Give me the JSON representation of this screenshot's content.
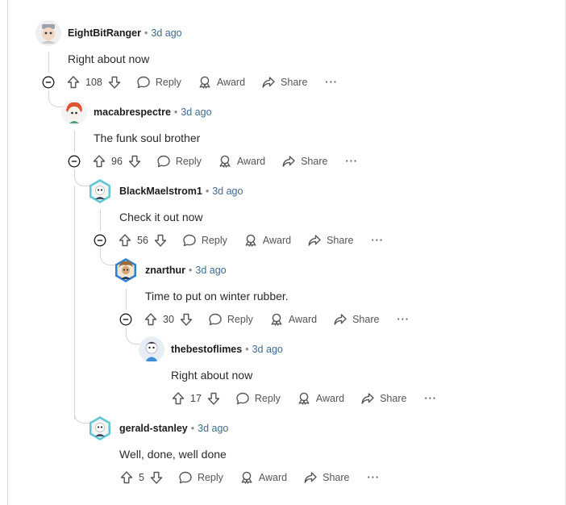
{
  "labels": {
    "reply": "Reply",
    "award": "Award",
    "share": "Share",
    "more": "···",
    "separator": "•"
  },
  "comments": [
    {
      "username": "EightBitRanger",
      "time": "3d ago",
      "body": "Right about now",
      "votes": "108",
      "avatar": "avatar-gray-hat"
    },
    {
      "username": "macabrespectre",
      "time": "3d ago",
      "body": "The funk soul brother",
      "votes": "96",
      "avatar": "avatar-red-hair"
    },
    {
      "username": "BlackMaelstrom1",
      "time": "3d ago",
      "body": "Check it out now",
      "votes": "56",
      "avatar": "avatar-snoo-hex"
    },
    {
      "username": "znarthur",
      "time": "3d ago",
      "body": "Time to put on winter rubber.",
      "votes": "30",
      "avatar": "avatar-brown-hex"
    },
    {
      "username": "thebestoflimes",
      "time": "3d ago",
      "body": "Right about now",
      "votes": "17",
      "avatar": "avatar-blue-snoo"
    },
    {
      "username": "gerald-stanley",
      "time": "3d ago",
      "body": "Well, done, well done",
      "votes": "5",
      "avatar": "avatar-snoo-hex"
    }
  ],
  "colors": {
    "link_time": "#3f6b8f",
    "thread_line": "#d4d4d4",
    "text_muted": "#555555"
  }
}
